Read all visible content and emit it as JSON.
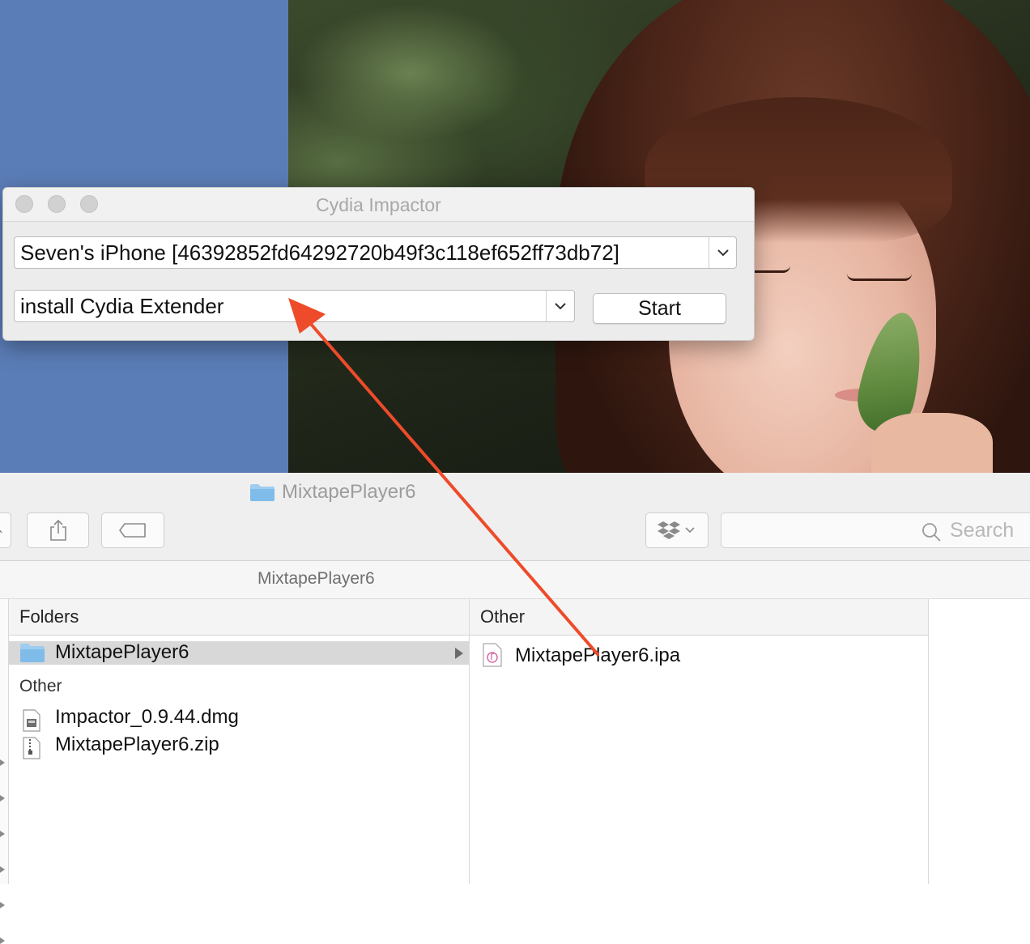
{
  "impactor": {
    "title": "Cydia Impactor",
    "device_value": "Seven's iPhone [46392852fd64292720b49f3c118ef652ff73db72]",
    "action_value": "install Cydia Extender",
    "start_label": "Start"
  },
  "finder": {
    "window_title": "MixtapePlayer6",
    "search_placeholder": "Search",
    "path_title": "MixtapePlayer6",
    "columns": [
      {
        "header": "Folders",
        "selected_folder": "MixtapePlayer6",
        "group_label": "Other",
        "files": [
          "Impactor_0.9.44.dmg",
          "MixtapePlayer6.zip"
        ]
      },
      {
        "header": "Other",
        "files": [
          "MixtapePlayer6.ipa"
        ]
      }
    ]
  },
  "colors": {
    "arrow": "#ee4b2b",
    "folder": "#8cc4ee",
    "desktop_blue": "#5b7db7"
  }
}
